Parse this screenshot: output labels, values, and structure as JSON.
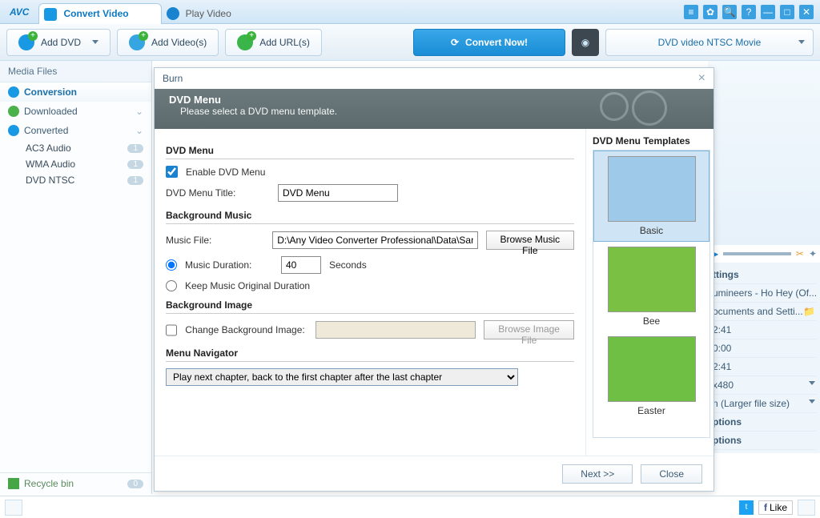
{
  "app": {
    "logo": "AVC"
  },
  "tabs": {
    "convert": "Convert Video",
    "play": "Play Video"
  },
  "toolbar": {
    "add_dvd": "Add DVD",
    "add_videos": "Add Video(s)",
    "add_urls": "Add URL(s)",
    "convert_now": "Convert Now!",
    "profile": "DVD video NTSC Movie"
  },
  "sidebar": {
    "header": "Media Files",
    "conversion": "Conversion",
    "downloaded": "Downloaded",
    "converted": "Converted",
    "subs": [
      {
        "label": "AC3 Audio",
        "badge": "1"
      },
      {
        "label": "WMA Audio",
        "badge": "1"
      },
      {
        "label": "DVD NTSC",
        "badge": "1"
      }
    ],
    "recycle": "Recycle bin",
    "recycle_badge": "0"
  },
  "rightpanel": {
    "settings_label": "ttings",
    "rows": {
      "track": "umineers - Ho Hey (Of...",
      "path": "ocuments and Setti...",
      "t1": "2:41",
      "start": "0:00",
      "t2": "2:41",
      "res": "x480",
      "quality": "n (Larger file size)",
      "opt1": "ptions",
      "opt2": "ptions"
    }
  },
  "modal": {
    "title": "Burn",
    "banner_title": "DVD Menu",
    "banner_sub": "Please select a DVD menu template.",
    "sec_dvd": "DVD Menu",
    "enable_label": "Enable DVD Menu",
    "title_label": "DVD Menu Title:",
    "title_value": "DVD Menu",
    "sec_music": "Background Music",
    "music_file_label": "Music File:",
    "music_file_value": "D:\\Any Video Converter Professional\\Data\\Sampl",
    "browse_music": "Browse Music File",
    "duration_label": "Music Duration:",
    "duration_value": "40",
    "seconds": "Seconds",
    "keep_original": "Keep Music Original Duration",
    "sec_image": "Background Image",
    "change_img_label": "Change Background Image:",
    "browse_image": "Browse Image File",
    "sec_nav": "Menu Navigator",
    "nav_value": "Play next chapter, back to the first chapter after the last chapter",
    "next": "Next >>",
    "close": "Close",
    "templates_header": "DVD Menu Templates",
    "templates": {
      "basic": "Basic",
      "bee": "Bee",
      "easter": "Easter"
    }
  },
  "bottombar": {
    "like": "Like"
  }
}
